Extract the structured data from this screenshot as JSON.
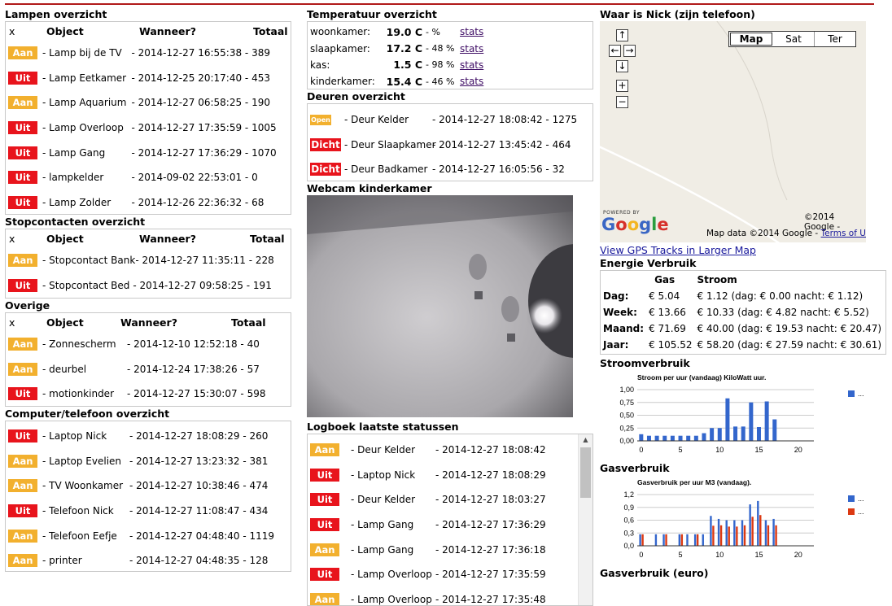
{
  "lampen": {
    "title": "Lampen overzicht",
    "headers": [
      "x",
      "Object",
      "Wanneer?",
      "Totaal"
    ],
    "rows": [
      {
        "status": "Aan",
        "name": "Lamp bij de TV",
        "when": "2014-12-27 16:55:38",
        "total": "389"
      },
      {
        "status": "Uit",
        "name": "Lamp Eetkamer",
        "when": "2014-12-25 20:17:40",
        "total": "453"
      },
      {
        "status": "Aan",
        "name": "Lamp Aquarium",
        "when": "2014-12-27 06:58:25",
        "total": "190"
      },
      {
        "status": "Uit",
        "name": "Lamp Overloop",
        "when": "2014-12-27 17:35:59",
        "total": "1005"
      },
      {
        "status": "Uit",
        "name": "Lamp Gang",
        "when": "2014-12-27 17:36:29",
        "total": "1070"
      },
      {
        "status": "Uit",
        "name": "lampkelder",
        "when": "2014-09-02 22:53:01",
        "total": "0"
      },
      {
        "status": "Uit",
        "name": "Lamp Zolder",
        "when": "2014-12-26 22:36:32",
        "total": "68"
      }
    ]
  },
  "stopcontacten": {
    "title": "Stopcontacten overzicht",
    "headers": [
      "x",
      "Object",
      "Wanneer?",
      "Totaal"
    ],
    "rows": [
      {
        "status": "Aan",
        "name": "Stopcontact Bank",
        "when": "2014-12-27 11:35:11",
        "total": "228"
      },
      {
        "status": "Uit",
        "name": "Stopcontact Bed",
        "when": "2014-12-27 09:58:25",
        "total": "191"
      }
    ]
  },
  "overige": {
    "title": "Overige",
    "headers": [
      "x",
      "Object",
      "Wanneer?",
      "Totaal"
    ],
    "rows": [
      {
        "status": "Aan",
        "name": "Zonnescherm",
        "when": "2014-12-10 12:52:18",
        "total": "40"
      },
      {
        "status": "Aan",
        "name": "deurbel",
        "when": "2014-12-24 17:38:26",
        "total": "57"
      },
      {
        "status": "Uit",
        "name": "motionkinder",
        "when": "2014-12-27 15:30:07",
        "total": "598"
      }
    ]
  },
  "computer": {
    "title": "Computer/telefoon overzicht",
    "rows": [
      {
        "status": "Uit",
        "name": "Laptop Nick",
        "when": "2014-12-27 18:08:29",
        "total": "260"
      },
      {
        "status": "Aan",
        "name": "Laptop Evelien",
        "when": "2014-12-27 13:23:32",
        "total": "381"
      },
      {
        "status": "Aan",
        "name": "TV Woonkamer",
        "when": "2014-12-27 10:38:46",
        "total": "474"
      },
      {
        "status": "Uit",
        "name": "Telefoon Nick",
        "when": "2014-12-27 11:08:47",
        "total": "434"
      },
      {
        "status": "Aan",
        "name": "Telefoon Eefje",
        "when": "2014-12-27 04:48:40",
        "total": "1119"
      },
      {
        "status": "Aan",
        "name": "printer",
        "when": "2014-12-27 04:48:35",
        "total": "128"
      }
    ]
  },
  "temperatuur": {
    "title": "Temperatuur overzicht",
    "rows": [
      {
        "room": "woonkamer:",
        "temp": "19.0 C",
        "hum": "- %",
        "link": "stats"
      },
      {
        "room": "slaapkamer:",
        "temp": "17.2 C",
        "hum": "- 48 %",
        "link": "stats"
      },
      {
        "room": "kas:",
        "temp": "1.5 C",
        "hum": "- 98 %",
        "link": "stats"
      },
      {
        "room": "kinderkamer:",
        "temp": "15.4 C",
        "hum": "- 46 %",
        "link": "stats"
      }
    ]
  },
  "deuren": {
    "title": "Deuren overzicht",
    "rows": [
      {
        "status": "Open",
        "name": "Deur Kelder",
        "when": "2014-12-27 18:08:42",
        "total": "1275"
      },
      {
        "status": "Dicht",
        "name": "Deur Slaapkamer",
        "when": "2014-12-27 13:45:42",
        "total": "464"
      },
      {
        "status": "Dicht",
        "name": "Deur Badkamer",
        "when": "2014-12-27 16:05:56",
        "total": "32"
      }
    ]
  },
  "webcam": {
    "title": "Webcam kinderkamer"
  },
  "logboek": {
    "title": "Logboek laatste statussen",
    "rows": [
      {
        "status": "Aan",
        "name": "Deur Kelder",
        "when": "2014-12-27 18:08:42"
      },
      {
        "status": "Uit",
        "name": "Laptop Nick",
        "when": "2014-12-27 18:08:29"
      },
      {
        "status": "Uit",
        "name": "Deur Kelder",
        "when": "2014-12-27 18:03:27"
      },
      {
        "status": "Uit",
        "name": "Lamp Gang",
        "when": "2014-12-27 17:36:29"
      },
      {
        "status": "Aan",
        "name": "Lamp Gang",
        "when": "2014-12-27 17:36:18"
      },
      {
        "status": "Uit",
        "name": "Lamp Overloop",
        "when": "2014-12-27 17:35:59"
      },
      {
        "status": "Aan",
        "name": "Lamp Overloop",
        "when": "2014-12-27 17:35:48"
      }
    ]
  },
  "map": {
    "title": "Waar is Nick (zijn telefoon)",
    "types": [
      "Map",
      "Sat",
      "Ter"
    ],
    "powered": "POWERED BY",
    "google": "Google",
    "copyright": "©2014 Google -",
    "mapdata": "Map data ©2014 Google -",
    "terms": "Terms of Use",
    "larger_link": "View GPS Tracks in Larger Map"
  },
  "energie": {
    "title": "Energie Verbruik",
    "headers": [
      "",
      "Gas",
      "Stroom"
    ],
    "rows": [
      {
        "period": "Dag:",
        "gas": "€ 5.04",
        "stroom": "€ 1.12 (dag: € 0.00 nacht: € 1.12)"
      },
      {
        "period": "Week:",
        "gas": "€ 13.66",
        "stroom": "€ 10.33 (dag: € 4.82 nacht: € 5.52)"
      },
      {
        "period": "Maand:",
        "gas": "€ 71.69",
        "stroom": "€ 40.00 (dag: € 19.53 nacht: € 20.47)"
      },
      {
        "period": "Jaar:",
        "gas": "€ 105.52",
        "stroom": "€ 58.20 (dag: € 27.59 nacht: € 30.61)"
      }
    ]
  },
  "stroomverbruik": {
    "title": "Stroomverbruik"
  },
  "gasverbruik": {
    "title": "Gasverbruik"
  },
  "gasverbruik_euro": {
    "title": "Gasverbruik (euro)"
  },
  "chart_data": [
    {
      "type": "bar",
      "title": "Stroom per uur (vandaag) KiloWatt uur.",
      "x": [
        0,
        1,
        2,
        3,
        4,
        5,
        6,
        7,
        8,
        9,
        10,
        11,
        12,
        13,
        14,
        15,
        16,
        17
      ],
      "series": [
        {
          "name": "...",
          "color": "#3366cc",
          "values": [
            0.13,
            0.1,
            0.1,
            0.1,
            0.1,
            0.1,
            0.1,
            0.1,
            0.15,
            0.25,
            0.25,
            0.83,
            0.28,
            0.28,
            0.75,
            0.27,
            0.77,
            0.42
          ]
        }
      ],
      "xticks": [
        0,
        5,
        10,
        15,
        20
      ],
      "yticks": [
        "0,00",
        "0,25",
        "0,50",
        "0,75",
        "1,00"
      ],
      "ylim": [
        0,
        1
      ],
      "xlim": [
        -0.5,
        22
      ],
      "legend": "right"
    },
    {
      "type": "bar",
      "title": "Gasverbruik per uur M3 (vandaag).",
      "x": [
        0,
        1,
        2,
        3,
        4,
        5,
        6,
        7,
        8,
        9,
        10,
        11,
        12,
        13,
        14,
        15,
        16,
        17
      ],
      "series": [
        {
          "name": "...",
          "color": "#3366cc",
          "values": [
            0.27,
            0,
            0.27,
            0.27,
            0,
            0.27,
            0.27,
            0.27,
            0.27,
            0.7,
            0.63,
            0.6,
            0.6,
            0.6,
            0.97,
            1.05,
            0.6,
            0.63
          ]
        },
        {
          "name": "...",
          "color": "#dc3912",
          "values": [
            0.27,
            0,
            0,
            0.27,
            0,
            0.27,
            0,
            0.27,
            0,
            0.47,
            0.48,
            0.45,
            0.45,
            0.48,
            0.68,
            0.72,
            0.48,
            0.48
          ]
        }
      ],
      "xticks": [
        0,
        5,
        10,
        15,
        20
      ],
      "yticks": [
        "0,0",
        "0,3",
        "0,6",
        "0,9",
        "1,2"
      ],
      "ylim": [
        0,
        1.2
      ],
      "xlim": [
        -0.5,
        22
      ],
      "legend": "right"
    }
  ]
}
